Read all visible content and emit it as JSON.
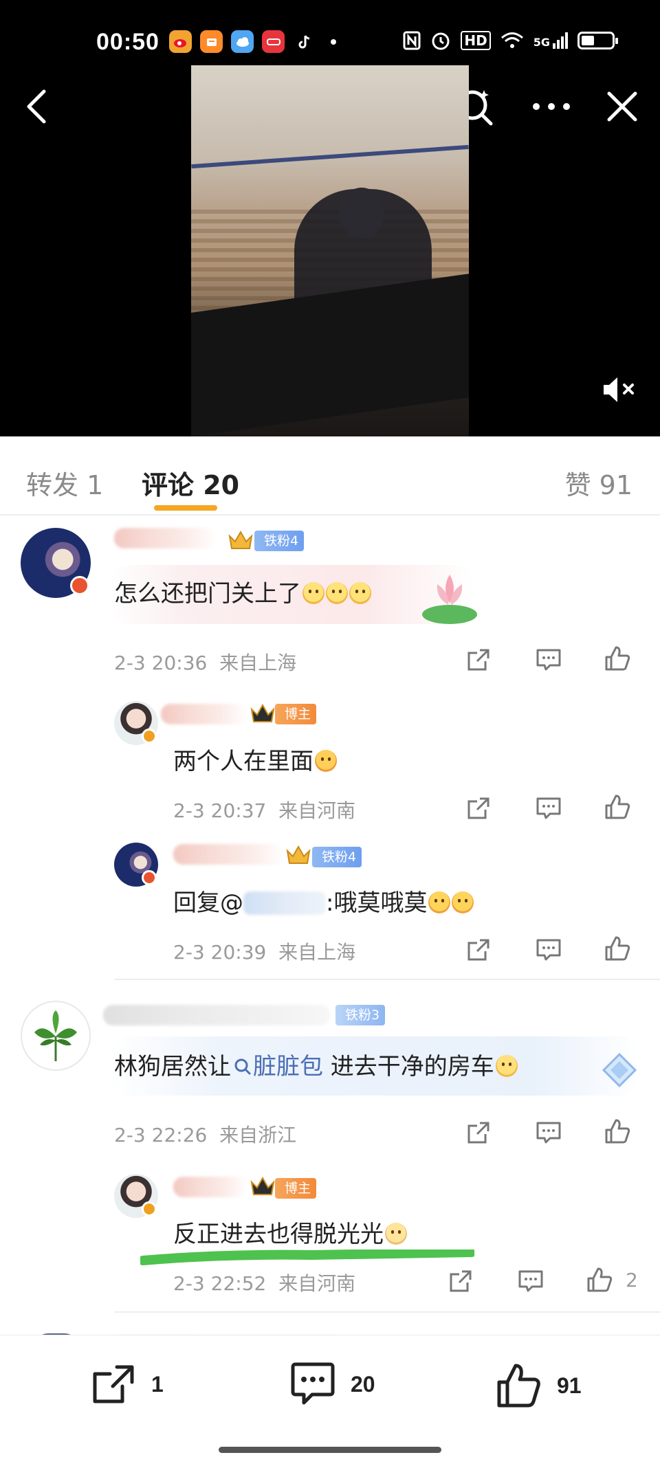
{
  "status_bar": {
    "time": "00:50",
    "app_icons": [
      "weibo-icon",
      "taobao-icon",
      "cloud-icon",
      "xianyu-icon",
      "tiktok-icon"
    ],
    "indicators": [
      "nfc-icon",
      "alarm-icon",
      "hd-icon",
      "wifi-icon",
      "5g-signal-icon",
      "battery-icon"
    ],
    "hd_label": "HD",
    "signal_label": "5G"
  },
  "nav": {
    "back_icon": "back-icon",
    "search_icon": "search-icon",
    "more_icon": "more-icon",
    "close_icon": "close-icon"
  },
  "video": {
    "mute_icon": "mute-icon"
  },
  "tabs": {
    "repost": "转发 1",
    "comments": "评论 20",
    "likes": "赞 91",
    "accent_color": "#f5a623"
  },
  "comments": [
    {
      "badge": "铁粉4",
      "text": "怎么还把门关上了",
      "time": "2-3 20:36",
      "location": "来自上海",
      "replies": [
        {
          "badge": "博主",
          "text": "两个人在里面",
          "time": "2-3 20:37",
          "location": "来自河南"
        },
        {
          "badge": "铁粉4",
          "text_prefix": "回复@",
          "text_suffix": ":哦莫哦莫",
          "time": "2-3 20:39",
          "location": "来自上海"
        }
      ]
    },
    {
      "badge": "铁粉3",
      "text_prefix": "林狗居然让",
      "link_text": "脏脏包",
      "text_suffix": " 进去干净的房车",
      "time": "2-3 22:26",
      "location": "来自浙江",
      "replies": [
        {
          "badge": "博主",
          "text": "反正进去也得脱光光",
          "time": "2-3 22:52",
          "location": "来自河南",
          "likes": "2"
        }
      ]
    }
  ],
  "bottom_bar": {
    "repost_count": "1",
    "comment_count": "20",
    "like_count": "91"
  }
}
